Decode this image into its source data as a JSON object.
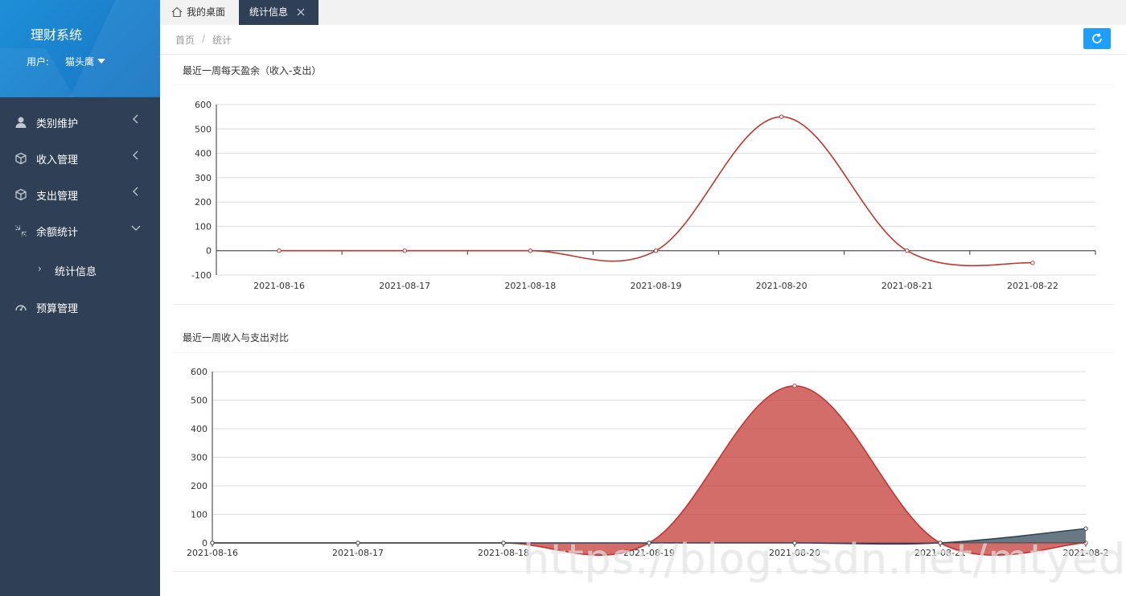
{
  "sidebar": {
    "app_title": "理财系统",
    "user_label": "用户:",
    "user_name": "猫头鹰",
    "items": [
      {
        "label": "类别维护",
        "icon": "user-icon"
      },
      {
        "label": "收入管理",
        "icon": "cube-icon"
      },
      {
        "label": "支出管理",
        "icon": "cube-icon"
      },
      {
        "label": "余额统计",
        "icon": "shrink-icon"
      },
      {
        "label": "预算管理",
        "icon": "gauge-icon"
      }
    ],
    "sub_item": {
      "label": "统计信息"
    }
  },
  "tabs": [
    {
      "label": "我的桌面",
      "icon": "home-icon"
    },
    {
      "label": "统计信息",
      "active": true
    }
  ],
  "breadcrumb": {
    "home": "首页",
    "separator": "/",
    "current": "统计"
  },
  "colors": {
    "sidebar": "#2f4056",
    "brand": "#1e8fd8",
    "accent": "#1e9fff",
    "series_red": "#c23531",
    "series_dark": "#2f4554"
  },
  "charts": {
    "surplus_title": "最近一周每天盈余（收入-支出）",
    "compare_title": "最近一周收入与支出对比",
    "truncated_last_label": "2021-08-2"
  },
  "chart_data": [
    {
      "type": "line",
      "title": "最近一周每天盈余（收入-支出）",
      "categories": [
        "2021-08-16",
        "2021-08-17",
        "2021-08-18",
        "2021-08-19",
        "2021-08-20",
        "2021-08-21",
        "2021-08-22"
      ],
      "series": [
        {
          "values": [
            0,
            0,
            0,
            0,
            550,
            0,
            -50
          ]
        }
      ],
      "yticks": [
        -100,
        0,
        100,
        200,
        300,
        400,
        500,
        600
      ],
      "ylim": [
        -100,
        600
      ],
      "smooth": true,
      "grid": true
    },
    {
      "type": "area",
      "title": "最近一周收入与支出对比",
      "categories": [
        "2021-08-16",
        "2021-08-17",
        "2021-08-18",
        "2021-08-19",
        "2021-08-20",
        "2021-08-21",
        "2021-08-22"
      ],
      "series": [
        {
          "values": [
            0,
            0,
            0,
            0,
            550,
            0,
            0
          ]
        },
        {
          "values": [
            0,
            0,
            0,
            0,
            0,
            0,
            50
          ]
        }
      ],
      "yticks": [
        0,
        100,
        200,
        300,
        400,
        500,
        600
      ],
      "ylim": [
        0,
        600
      ],
      "smooth": true,
      "grid": true
    }
  ],
  "watermark": "https://blog.csdn.net/mtyedu"
}
